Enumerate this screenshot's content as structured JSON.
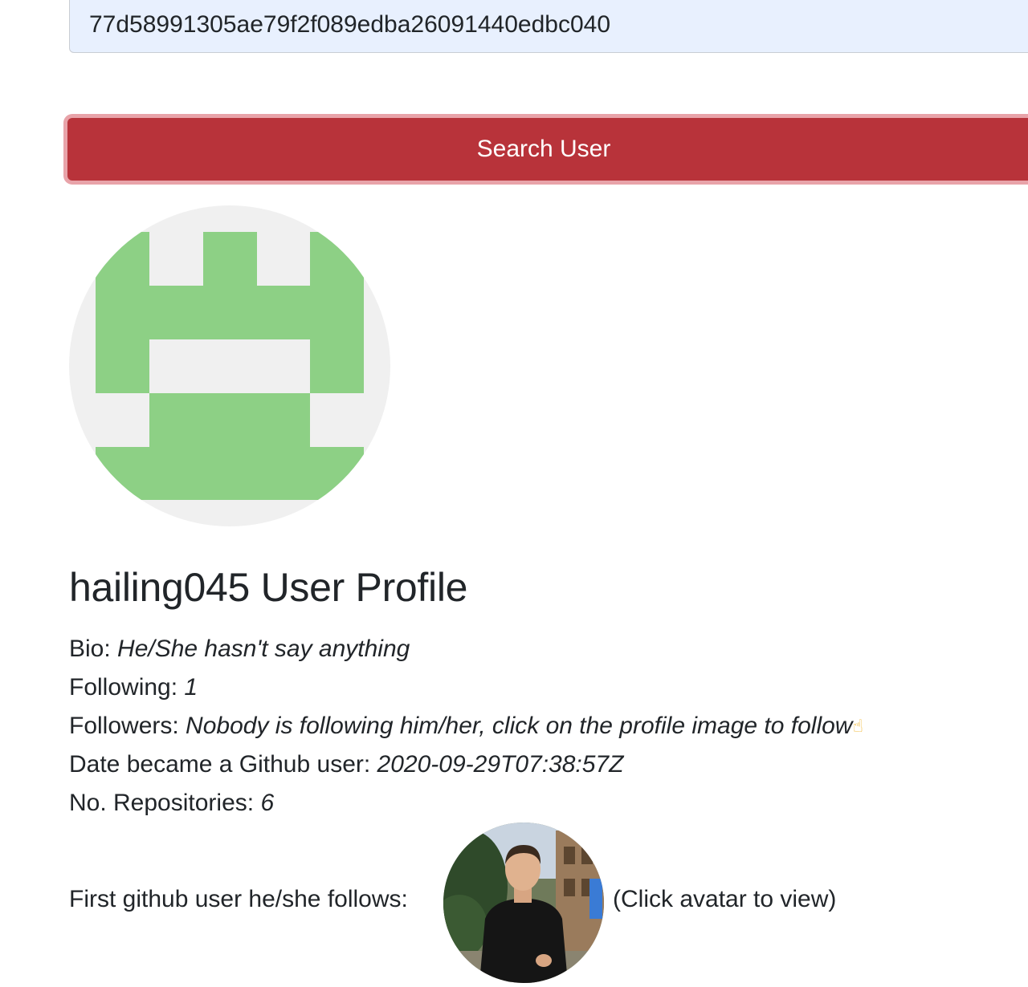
{
  "search": {
    "value": "77d58991305ae79f2f089edba26091440edbc040",
    "button_label": "Search User"
  },
  "profile": {
    "title": "hailing045 User Profile",
    "avatar_icon": "identicon-avatar",
    "avatar_colors": {
      "background": "#f0f0f0",
      "foreground": "#8dd085"
    },
    "bio_label": "Bio: ",
    "bio_value": "He/She hasn't say anything",
    "following_label": "Following: ",
    "following_value": "1",
    "followers_label": "Followers: ",
    "followers_value": "Nobody is following him/her, click on the profile image to follow",
    "followers_icon": "pointing-up-hand-icon",
    "date_label": "Date became a Github user: ",
    "date_value": "2020-09-29T07:38:57Z",
    "repos_label": "No. Repositories: ",
    "repos_value": "6",
    "first_follow_label": "First github user he/she follows: ",
    "first_follow_hint": "(Click avatar to view)"
  },
  "colors": {
    "button": "#b8333a",
    "button_focus_ring": "#e8a3a9",
    "input_background": "#e8f0fe",
    "text": "#212529"
  }
}
